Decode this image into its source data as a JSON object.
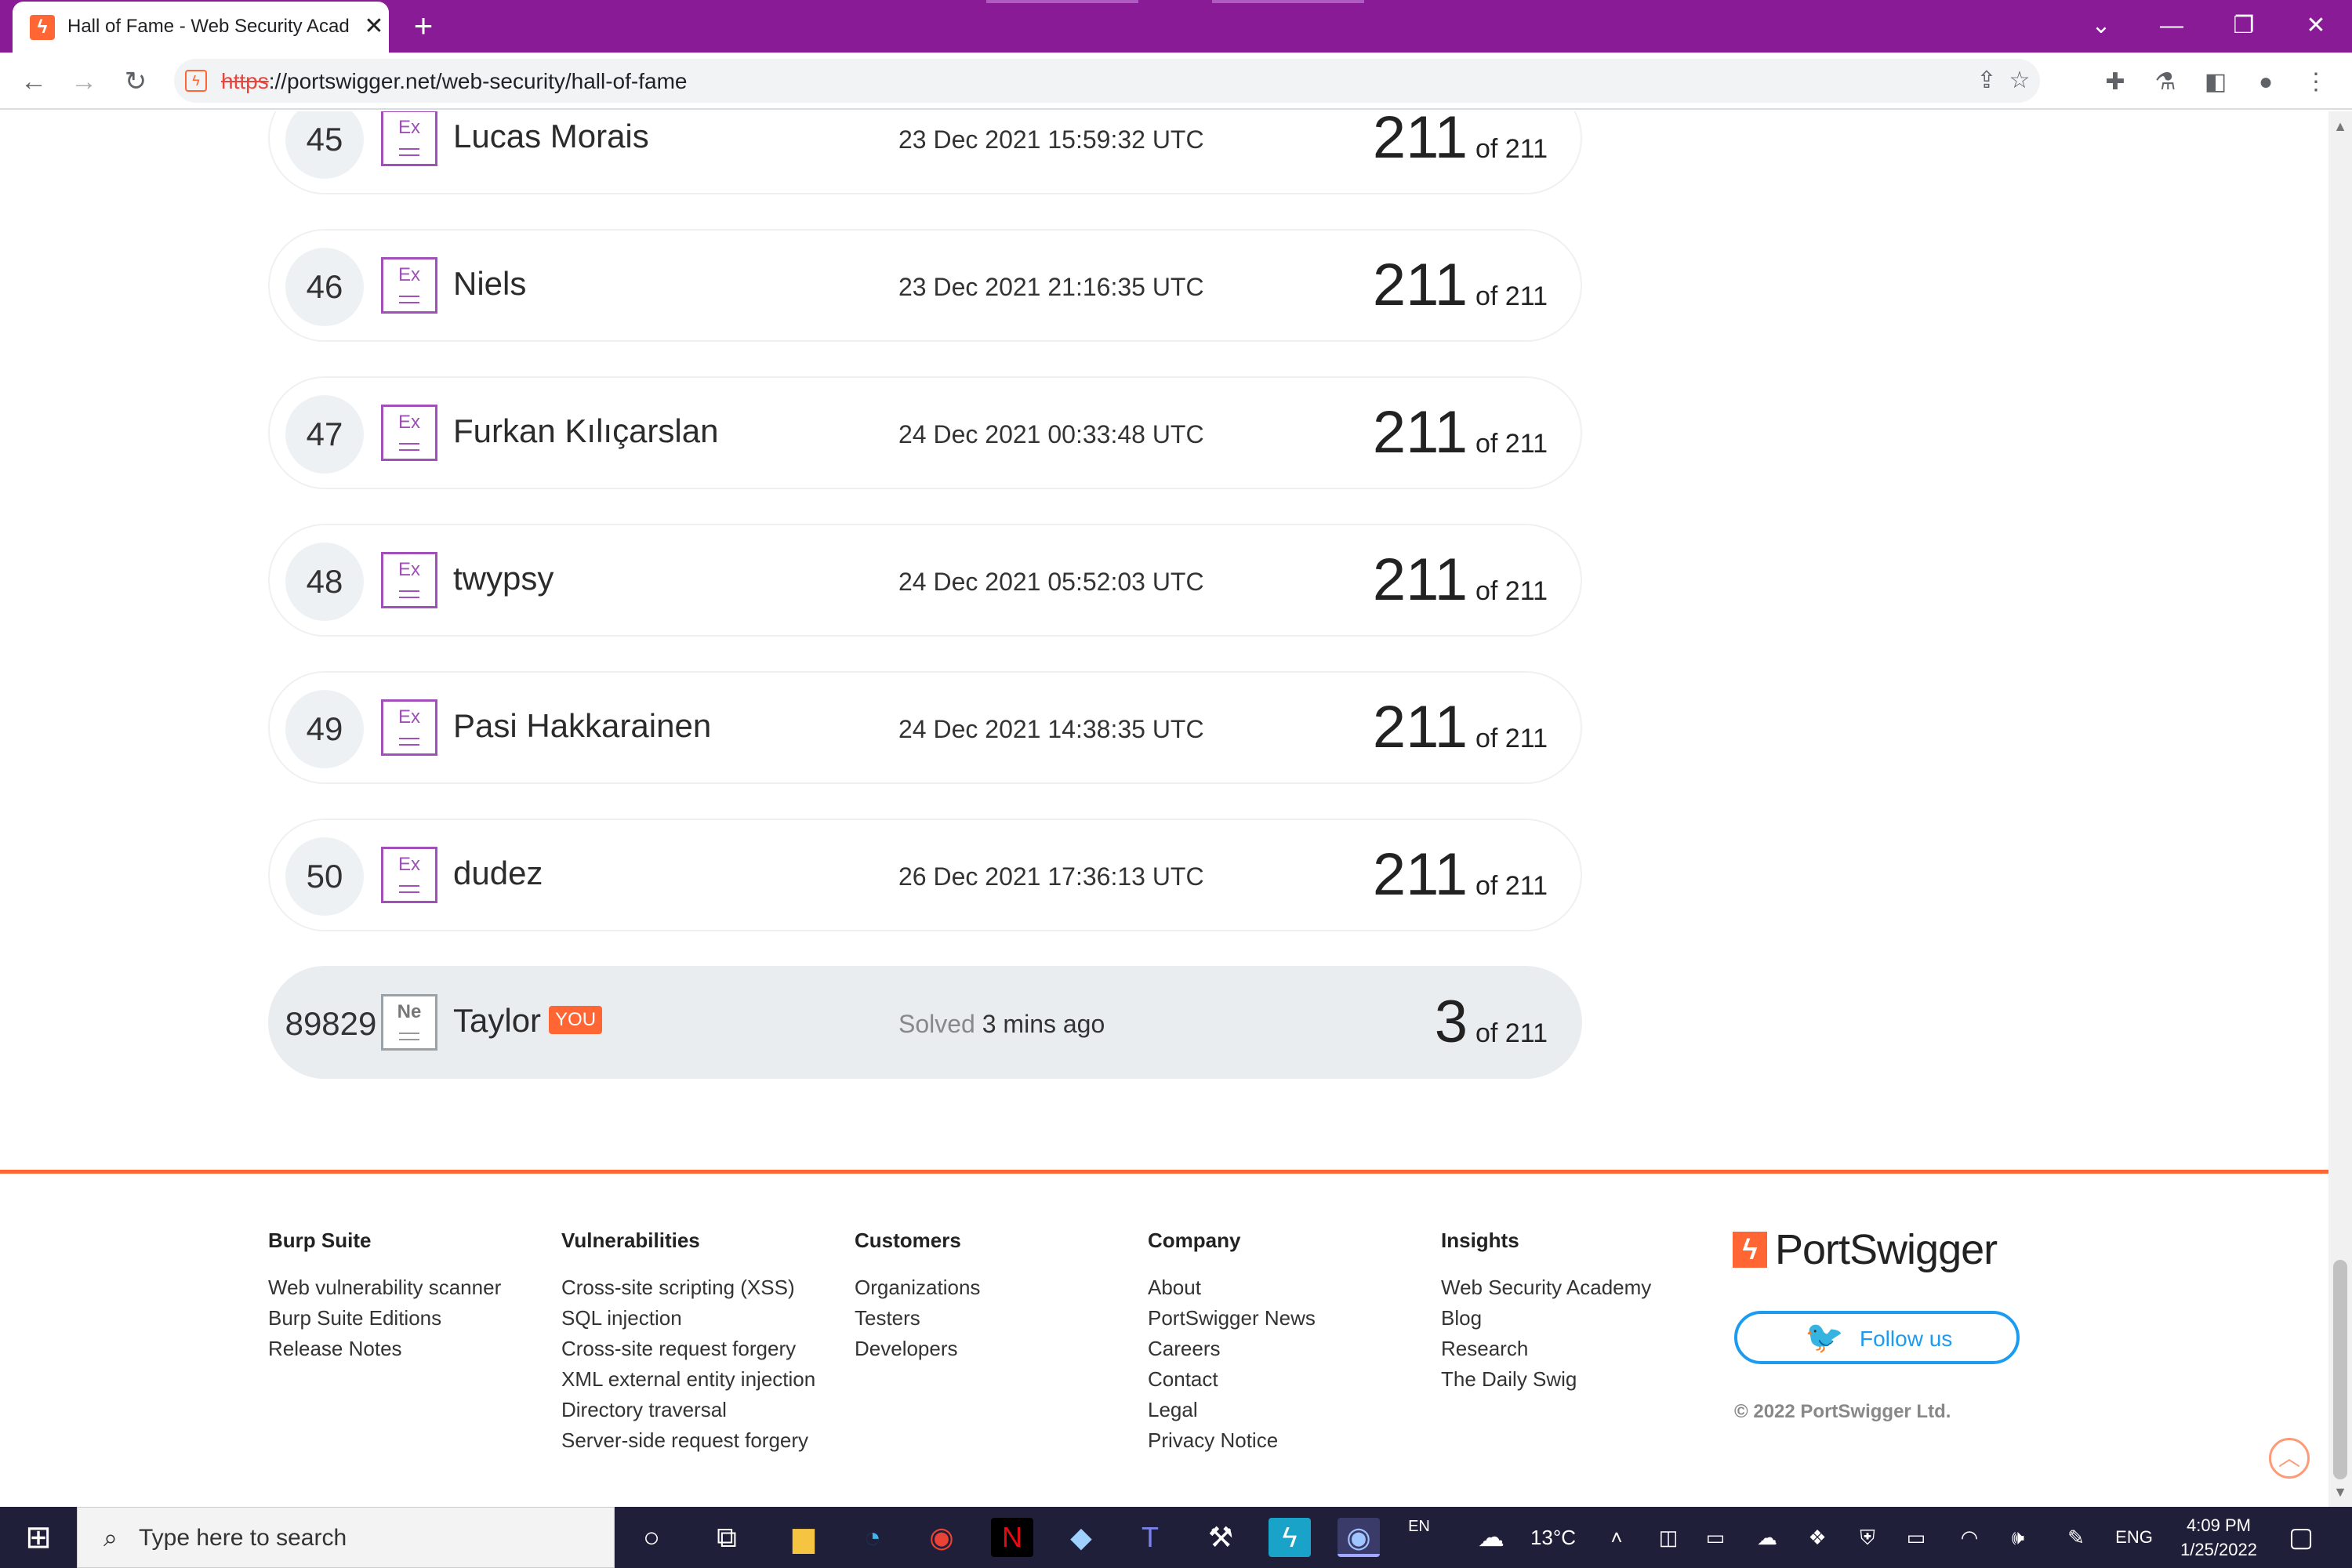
{
  "browser": {
    "tab_title": "Hall of Fame - Web Security Academy",
    "tab_close": "✕",
    "new_tab": "+",
    "url_scheme": "https",
    "url_rest": "://portswigger.net/web-security/hall-of-fame",
    "window_controls": {
      "dropdown": "⌄",
      "minimize": "—",
      "restore": "❐",
      "close": "✕"
    }
  },
  "leaderboard": [
    {
      "rank": "45",
      "badge": "Ex",
      "name": "Lucas Morais",
      "date": "23 Dec 2021 15:59:32 UTC",
      "score": "211",
      "of_total": "of 211"
    },
    {
      "rank": "46",
      "badge": "Ex",
      "name": "Niels",
      "date": "23 Dec 2021 21:16:35 UTC",
      "score": "211",
      "of_total": "of 211"
    },
    {
      "rank": "47",
      "badge": "Ex",
      "name": "Furkan Kılıçarslan",
      "date": "24 Dec 2021 00:33:48 UTC",
      "score": "211",
      "of_total": "of 211"
    },
    {
      "rank": "48",
      "badge": "Ex",
      "name": "twypsy",
      "date": "24 Dec 2021 05:52:03 UTC",
      "score": "211",
      "of_total": "of 211"
    },
    {
      "rank": "49",
      "badge": "Ex",
      "name": "Pasi Hakkarainen",
      "date": "24 Dec 2021 14:38:35 UTC",
      "score": "211",
      "of_total": "of 211"
    },
    {
      "rank": "50",
      "badge": "Ex",
      "name": "dudez",
      "date": "26 Dec 2021 17:36:13 UTC",
      "score": "211",
      "of_total": "of 211"
    }
  ],
  "you_row": {
    "rank": "89829",
    "badge": "Ne",
    "name": "Taylor",
    "you_tag": "YOU",
    "solved_label": "Solved",
    "solved_time": "3 mins ago",
    "score": "3",
    "of_total": "of 211"
  },
  "footer": {
    "columns": [
      {
        "heading": "Burp Suite",
        "links": [
          "Web vulnerability scanner",
          "Burp Suite Editions",
          "Release Notes"
        ]
      },
      {
        "heading": "Vulnerabilities",
        "links": [
          "Cross-site scripting (XSS)",
          "SQL injection",
          "Cross-site request forgery",
          "XML external entity injection",
          "Directory traversal",
          "Server-side request forgery"
        ]
      },
      {
        "heading": "Customers",
        "links": [
          "Organizations",
          "Testers",
          "Developers"
        ]
      },
      {
        "heading": "Company",
        "links": [
          "About",
          "PortSwigger News",
          "Careers",
          "Contact",
          "Legal",
          "Privacy Notice"
        ]
      },
      {
        "heading": "Insights",
        "links": [
          "Web Security Academy",
          "Blog",
          "Research",
          "The Daily Swig"
        ]
      }
    ],
    "brand_name": "PortSwigger",
    "follow_label": "Follow us",
    "copyright": "© 2022 PortSwigger Ltd."
  },
  "taskbar": {
    "search_placeholder": "Type here to search",
    "lang_top": "EN",
    "weather": "13°C",
    "lang": "ENG",
    "time": "4:09 PM",
    "date": "1/25/2022"
  },
  "colors": {
    "browser_frame": "#8a1b96",
    "accent_orange": "#ff6633",
    "badge_purple": "#a050b8",
    "twitter_blue": "#1d9bf0"
  }
}
